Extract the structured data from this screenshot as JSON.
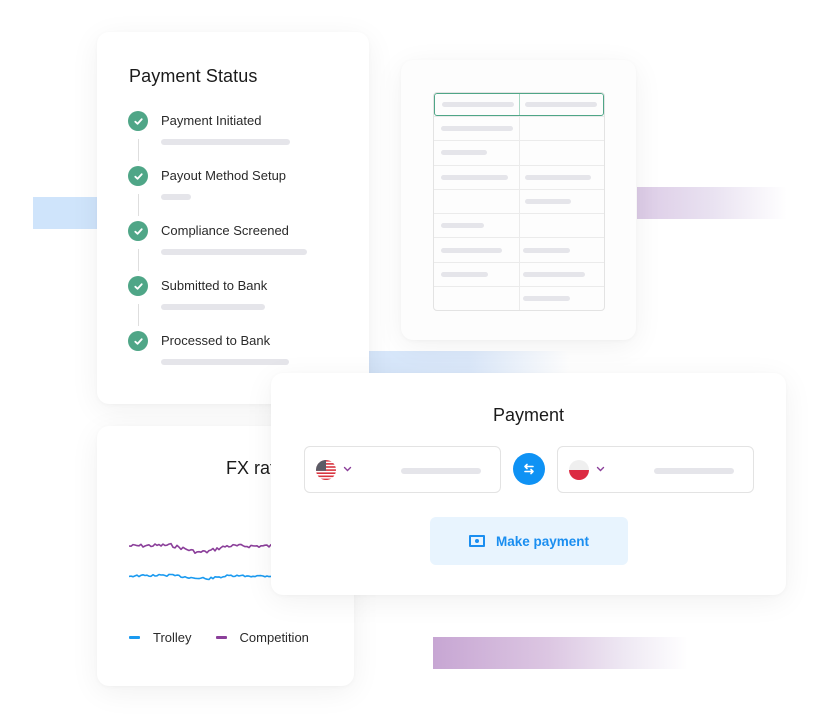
{
  "colors": {
    "success_green": "#4fa687",
    "accent_blue": "#0f92f4",
    "button_text_blue": "#1a8ef0",
    "button_bg": "#e8f4fe",
    "trolley_line": "#1a9af0",
    "competition_line": "#8b3f9a",
    "placeholder_bar": "#e5e5ea",
    "chevron_purple": "#8b3f9a"
  },
  "payment_status": {
    "title": "Payment Status",
    "steps": [
      {
        "label": "Payment Initiated",
        "status": "complete",
        "icon": "check-circle-icon"
      },
      {
        "label": "Payout Method Setup",
        "status": "complete",
        "icon": "check-circle-icon"
      },
      {
        "label": "Compliance Screened",
        "status": "complete",
        "icon": "check-circle-icon"
      },
      {
        "label": "Submitted to Bank",
        "status": "complete",
        "icon": "check-circle-icon"
      },
      {
        "label": "Processed to Bank",
        "status": "complete",
        "icon": "check-circle-icon"
      }
    ]
  },
  "table_preview": {
    "rows": [
      {
        "header": true,
        "cells": [
          true,
          true
        ]
      },
      {
        "cells": [
          true,
          false
        ]
      },
      {
        "cells": [
          true,
          false
        ]
      },
      {
        "cells": [
          true,
          true
        ]
      },
      {
        "cells": [
          false,
          true
        ]
      },
      {
        "cells": [
          true,
          false
        ]
      },
      {
        "cells": [
          true,
          true
        ]
      },
      {
        "cells": [
          true,
          true
        ]
      },
      {
        "cells": [
          false,
          true
        ]
      }
    ]
  },
  "fx_rate": {
    "title": "FX rate",
    "legend": [
      {
        "label": "Trolley",
        "color": "#1a9af0"
      },
      {
        "label": "Competition",
        "color": "#8b3f9a"
      }
    ]
  },
  "payment": {
    "title": "Payment",
    "from_currency": {
      "flag": "us-flag-icon",
      "country": "United States"
    },
    "to_currency": {
      "flag": "poland-flag-icon",
      "country": "Poland"
    },
    "swap_icon": "swap-arrows-icon",
    "make_payment_label": "Make payment",
    "make_payment_icon": "banknote-icon"
  }
}
